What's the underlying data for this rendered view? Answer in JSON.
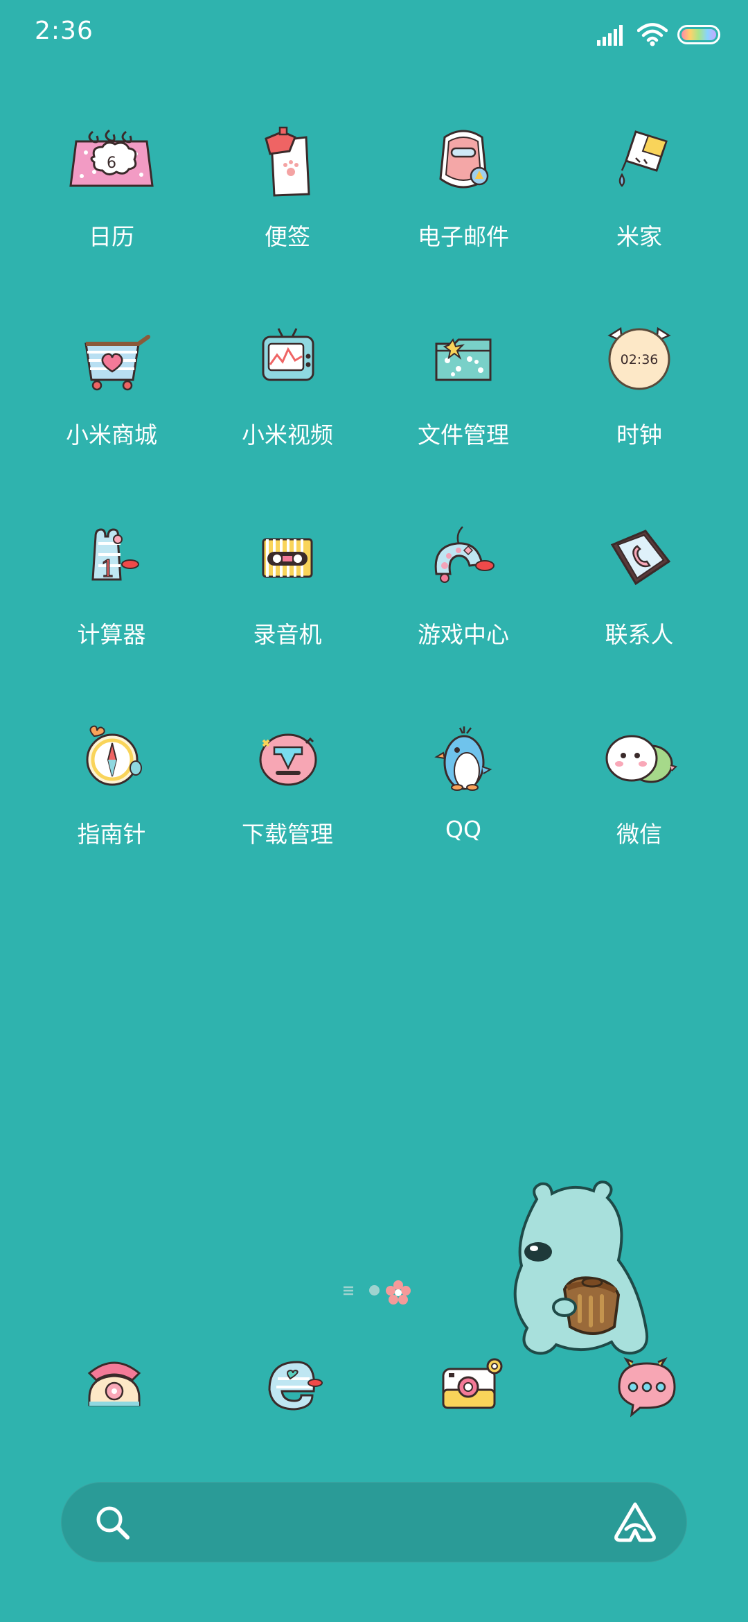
{
  "status_bar": {
    "time": "2:36"
  },
  "apps": [
    {
      "label": "日历",
      "icon": "calendar-icon",
      "calendar_day": "6"
    },
    {
      "label": "便签",
      "icon": "notes-icon"
    },
    {
      "label": "电子邮件",
      "icon": "email-icon"
    },
    {
      "label": "米家",
      "icon": "mijia-icon"
    },
    {
      "label": "小米商城",
      "icon": "mi-store-icon"
    },
    {
      "label": "小米视频",
      "icon": "mi-video-icon"
    },
    {
      "label": "文件管理",
      "icon": "file-manager-icon"
    },
    {
      "label": "时钟",
      "icon": "clock-icon",
      "clock_time": "02:36"
    },
    {
      "label": "计算器",
      "icon": "calculator-icon"
    },
    {
      "label": "录音机",
      "icon": "recorder-icon"
    },
    {
      "label": "游戏中心",
      "icon": "game-center-icon"
    },
    {
      "label": "联系人",
      "icon": "contacts-icon"
    },
    {
      "label": "指南针",
      "icon": "compass-icon"
    },
    {
      "label": "下载管理",
      "icon": "downloads-icon"
    },
    {
      "label": "QQ",
      "icon": "qq-icon"
    },
    {
      "label": "微信",
      "icon": "wechat-icon"
    }
  ],
  "dock": [
    {
      "icon": "phone-icon"
    },
    {
      "icon": "browser-icon"
    },
    {
      "icon": "camera-icon"
    },
    {
      "icon": "messages-icon"
    }
  ],
  "colors": {
    "background": "#2fb3ae",
    "search_bar": "#2a9b97",
    "label_text": "#ffffff"
  }
}
